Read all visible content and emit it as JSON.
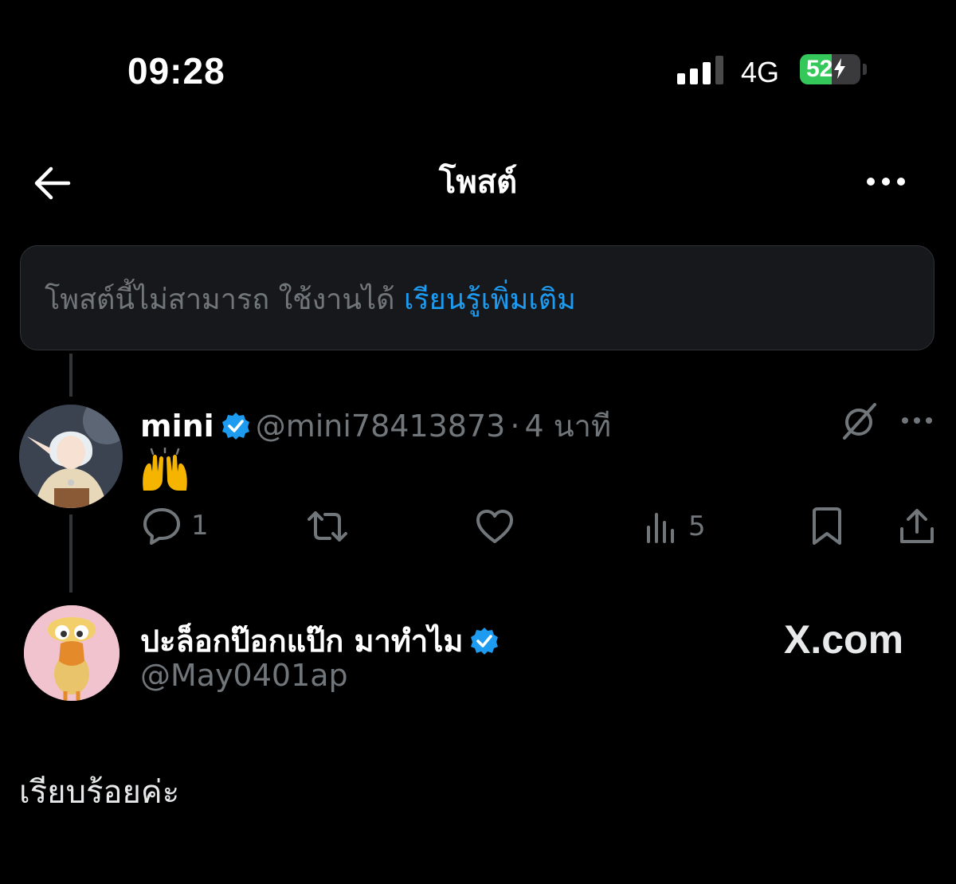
{
  "status_bar": {
    "time": "09:28",
    "network": "4G",
    "battery_level": "52",
    "battery_percent": 52,
    "battery_color": "#34c759"
  },
  "header": {
    "back_icon": "arrow-left-icon",
    "title": "โพสต์",
    "more_icon": "ellipsis-icon"
  },
  "unavailable": {
    "message": "โพสต์นี้ไม่สามารถ ใช้งานได้",
    "link": "เรียนรู้เพิ่มเติม",
    "link_color": "#1d9bf0"
  },
  "reply_tweet": {
    "display_name": "mini",
    "verified": true,
    "handle": "@mini78413873",
    "separator": "·",
    "time": "4 นาที",
    "content_emoji": "raising-hands-emoji",
    "actions": {
      "reply_count": "1",
      "retweet_count": "",
      "like_count": "",
      "views_count": "5"
    }
  },
  "main_tweet": {
    "display_name": "ปะล็อกป๊อกแป๊ก มาทำไม",
    "verified": true,
    "handle": "@May0401ap",
    "watermark": "X.com",
    "text": "เรียบร้อยค่ะ"
  },
  "colors": {
    "background": "#000000",
    "verified_blue": "#1d9bf0",
    "muted": "#71767b"
  }
}
